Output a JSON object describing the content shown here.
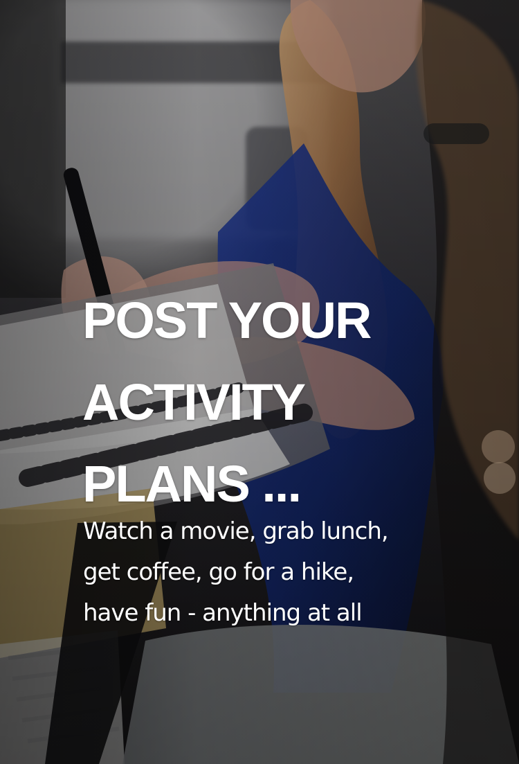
{
  "hero": {
    "headline_lines": [
      "POST YOUR",
      "ACTIVITY",
      "PLANS ..."
    ],
    "description_lines": [
      "Watch a movie, grab lunch,",
      "get coffee, go for a hike,",
      "have fun - anything at all"
    ]
  }
}
